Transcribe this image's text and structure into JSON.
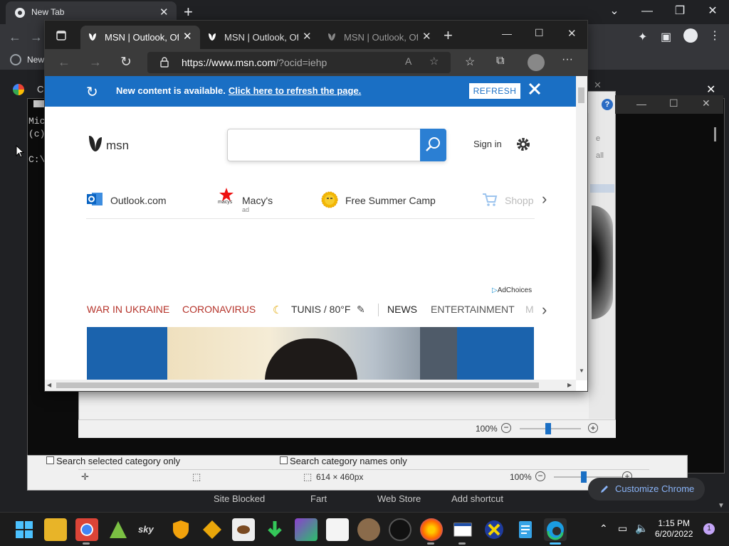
{
  "chrome": {
    "tab_title": "New Tab",
    "bookmark_label": "New",
    "partial_label": "C",
    "shortcuts": [
      "Site Blocked",
      "Fart",
      "Web Store",
      "Add shortcut"
    ],
    "customize_label": "Customize Chrome"
  },
  "cmd": {
    "lines": "Mic\n(c)\n\nC:\\"
  },
  "ie_window": {
    "side_text_1": "e",
    "side_text_2": "all",
    "zoom": "100%"
  },
  "paint": {
    "check1": "Search selected category only",
    "check2": "Search category names only",
    "size": "614 × 460px",
    "zoom": "100%"
  },
  "edge": {
    "tabs": [
      {
        "label": "MSN | Outlook, Office"
      },
      {
        "label": "MSN | Outlook, Office"
      },
      {
        "label": "MSN | Outlook, Office"
      }
    ],
    "url_host": "https://www.msn.com",
    "url_path": "/?ocid=iehp",
    "notice": {
      "message": "New content is available.",
      "link": "Click here to refresh the page.",
      "button": "REFRESH"
    },
    "msn_word": "msn",
    "search_placeholder": "",
    "signin": "Sign in",
    "quicklinks": [
      {
        "label": "Outlook.com",
        "sub": ""
      },
      {
        "label": "Macy's",
        "sub": "ad"
      },
      {
        "label": "Free Summer Camp",
        "sub": ""
      },
      {
        "label": "Shopp",
        "sub": ""
      }
    ],
    "macys_icon_text": "macys",
    "adchoices": "AdChoices",
    "nav": {
      "war": "WAR IN UKRAINE",
      "corona": "CORONAVIRUS",
      "weather": "TUNIS / 80°F",
      "news": "NEWS",
      "entertainment": "ENTERTAINMENT",
      "more": "M"
    }
  },
  "taskbar": {
    "time": "1:15 PM",
    "date": "6/20/2022",
    "badge": "1"
  },
  "colors": {
    "msn_blue": "#1a6fc4",
    "nav_red": "#b5332a",
    "edge_dark": "#202020"
  }
}
